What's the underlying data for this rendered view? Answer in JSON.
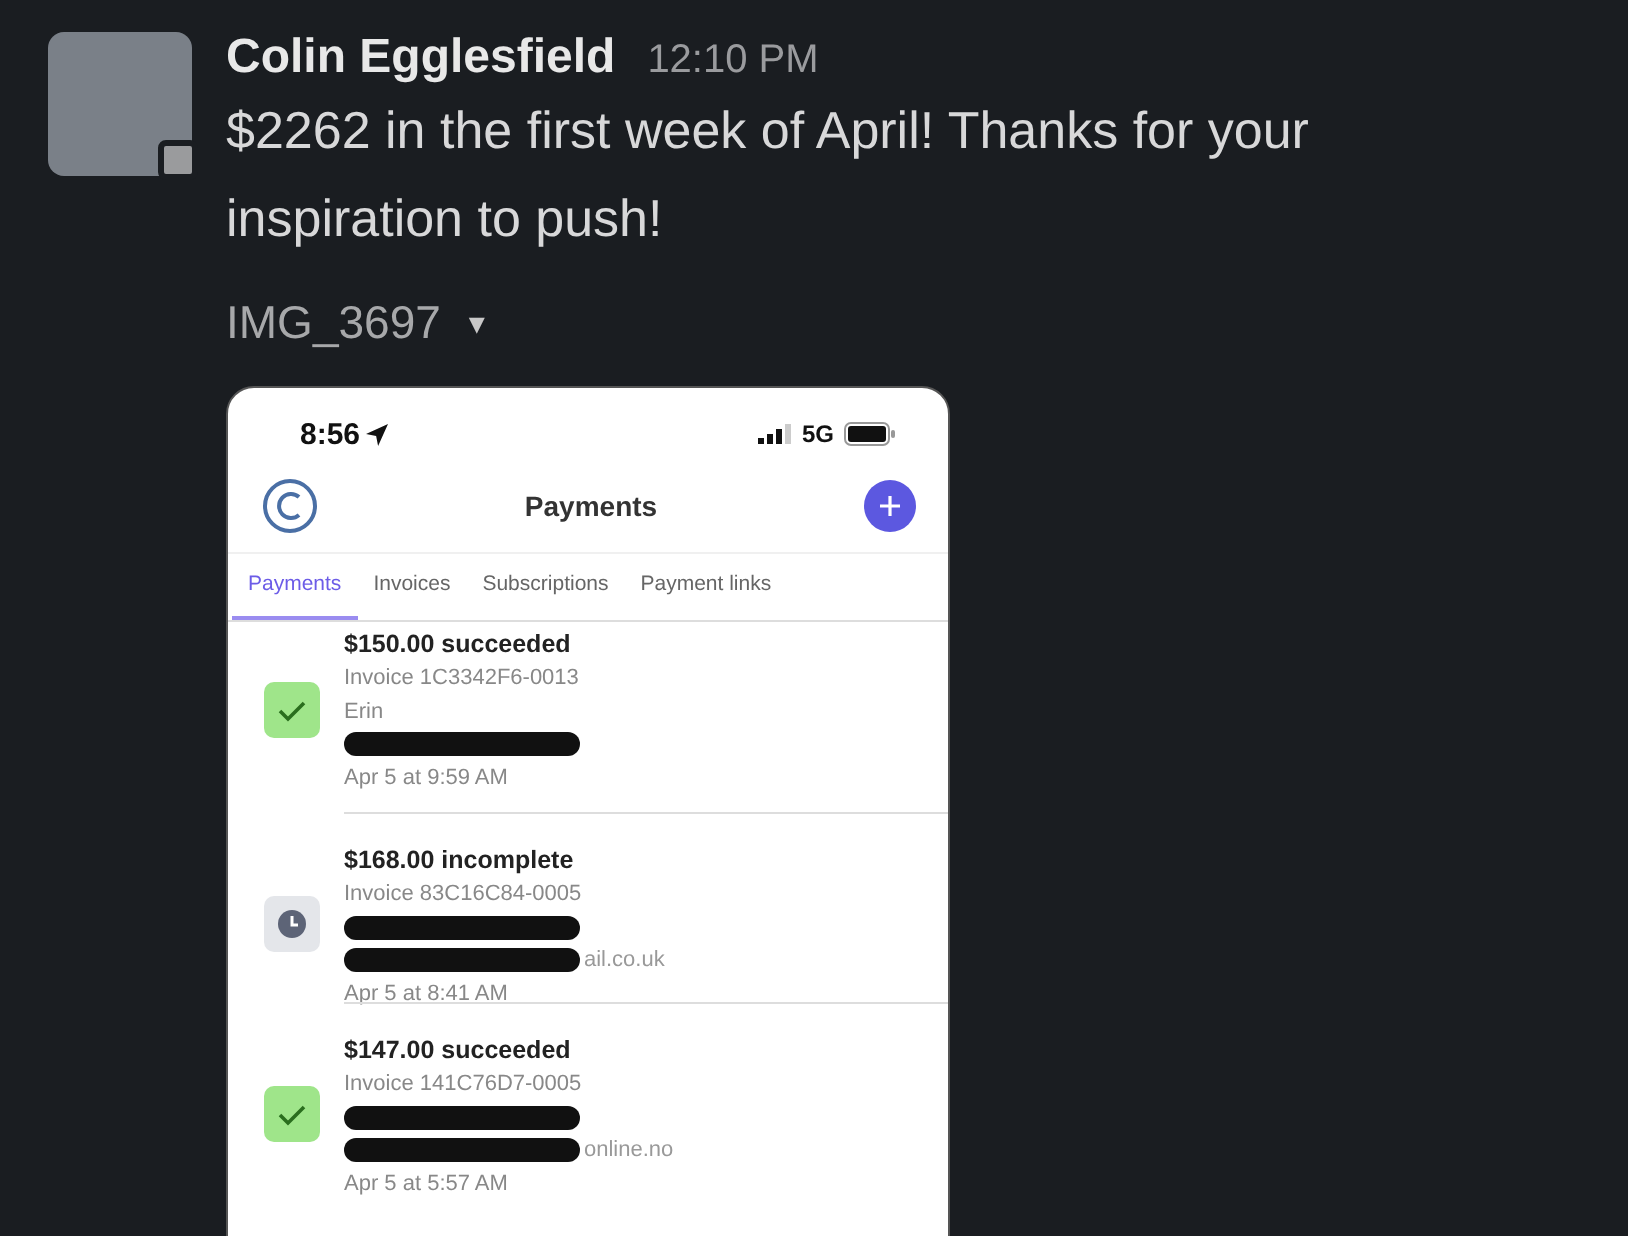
{
  "message": {
    "author": "Colin Egglesfield",
    "time": "12:10 PM",
    "away": true,
    "text": "$2262 in the first week of April! Thanks for your inspiration to push!"
  },
  "attachment": {
    "file_name": "IMG_3697",
    "caret": "▾"
  },
  "phone": {
    "status_bar": {
      "time": "8:56",
      "network": "5G"
    },
    "header": {
      "title": "Payments"
    },
    "tabs": [
      {
        "label": "Payments",
        "selected": true
      },
      {
        "label": "Invoices",
        "selected": false
      },
      {
        "label": "Subscriptions",
        "selected": false
      },
      {
        "label": "Payment links",
        "selected": false
      }
    ],
    "payments": [
      {
        "kind": "succeeded",
        "title": "$150.00 succeeded",
        "invoice": "Invoice 1C3342F6-0013",
        "lines": [
          {
            "kind": "text",
            "text": "Erin"
          },
          {
            "kind": "redacted"
          }
        ],
        "date": "Apr 5 at 9:59 AM"
      },
      {
        "kind": "incomplete",
        "title": "$168.00 incomplete",
        "invoice": "Invoice 83C16C84-0005",
        "lines": [
          {
            "kind": "redacted"
          },
          {
            "kind": "redacted",
            "tail": "ail.co.uk"
          }
        ],
        "date": "Apr 5 at 8:41 AM"
      },
      {
        "kind": "succeeded",
        "title": "$147.00 succeeded",
        "invoice": "Invoice 141C76D7-0005",
        "lines": [
          {
            "kind": "redacted"
          },
          {
            "kind": "redacted",
            "tail": "online.no"
          }
        ],
        "date": "Apr 5 at 5:57 AM"
      }
    ]
  }
}
